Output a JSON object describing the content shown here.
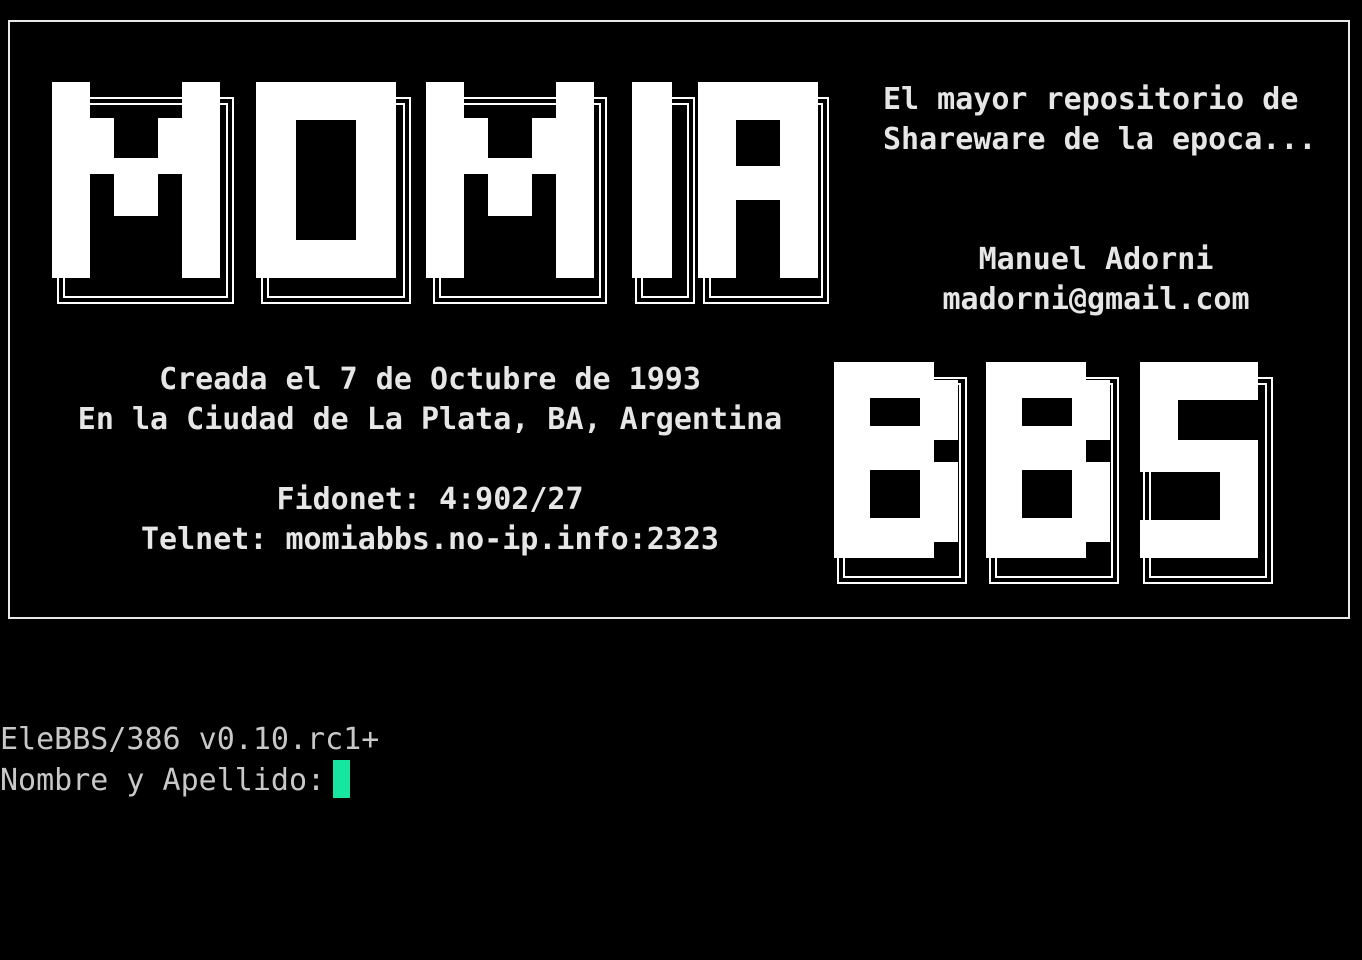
{
  "banner": {
    "title_art": "MOMIA",
    "subtitle_art": "BBS",
    "tagline_line1": "El mayor repositorio de",
    "tagline_line2": "Shareware de la epoca...",
    "author_name": "Manuel Adorni",
    "author_email": "madorni@gmail.com",
    "created_line": "Creada el 7 de Octubre de 1993",
    "location_line": "En la Ciudad de La Plata, BA, Argentina",
    "fidonet_label": "Fidonet:",
    "fidonet_value": "4:902/27",
    "telnet_label": "Telnet:",
    "telnet_value": "momiabbs.no-ip.info:2323"
  },
  "terminal": {
    "version": "EleBBS/386 v0.10.rc1+",
    "prompt": "Nombre y Apellido:",
    "cursor_color": "#17e6a0"
  }
}
